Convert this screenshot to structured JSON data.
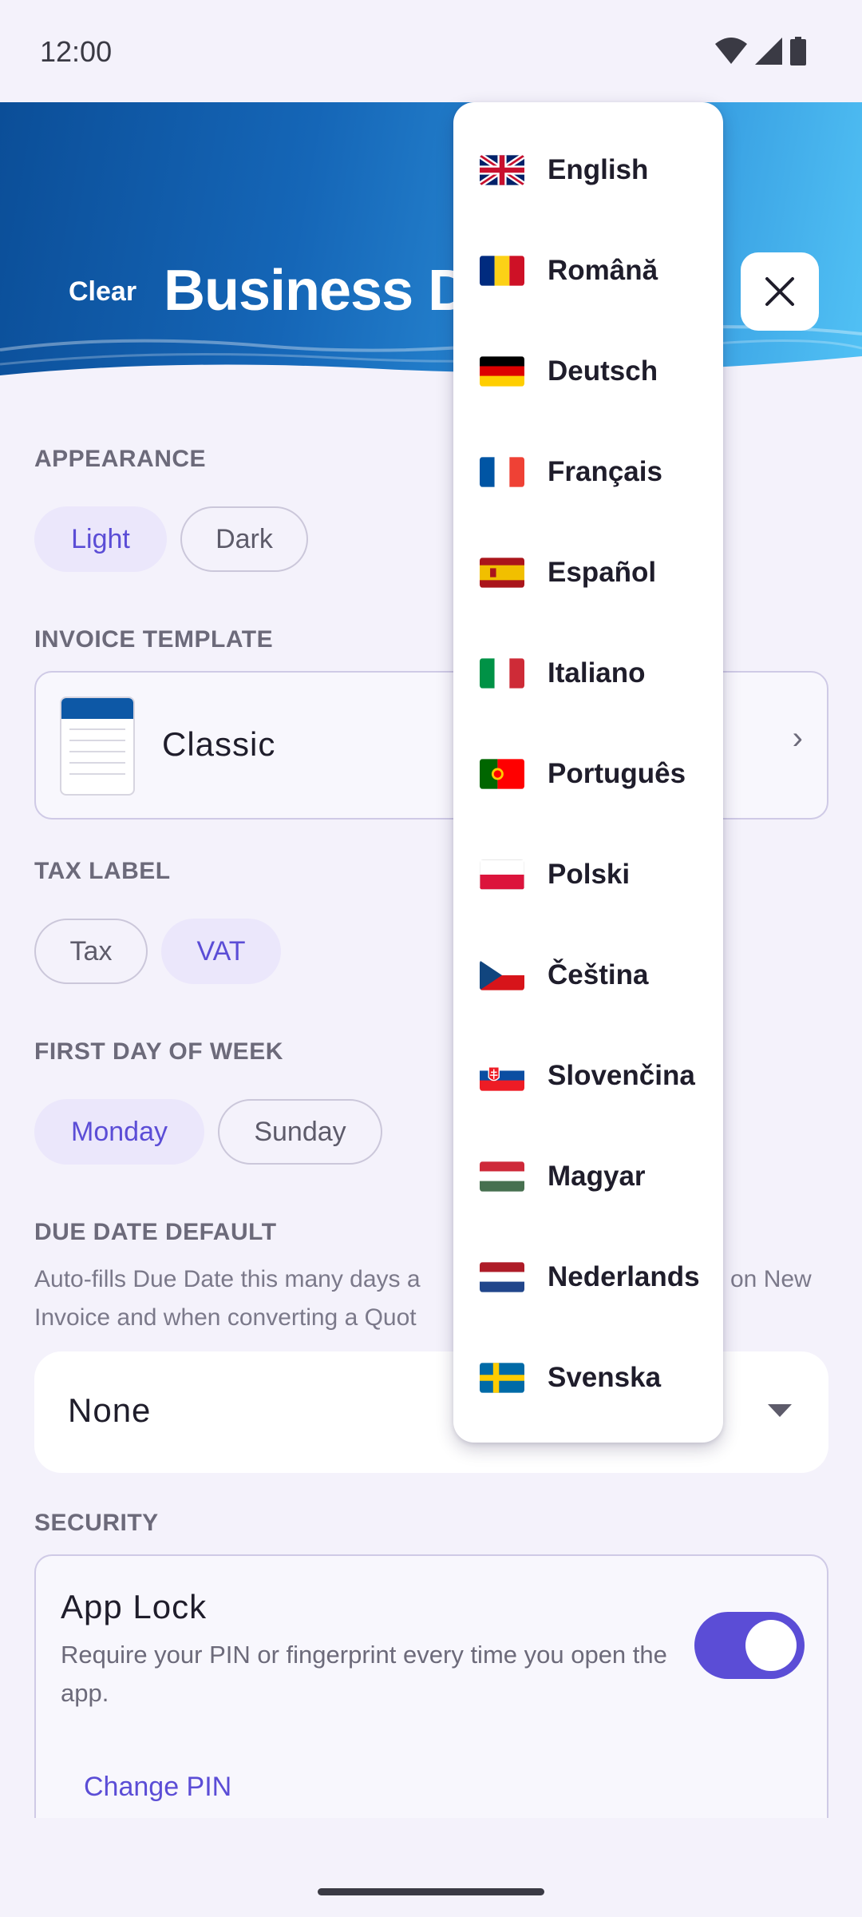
{
  "status_bar": {
    "time": "12:00"
  },
  "header": {
    "clear_label": "Clear",
    "title": "Business Details"
  },
  "appearance": {
    "label": "APPEARANCE",
    "options": [
      "Light",
      "Dark"
    ],
    "selected": "Light"
  },
  "invoice_template": {
    "label": "INVOICE TEMPLATE",
    "value": "Classic"
  },
  "tax_label": {
    "label": "TAX LABEL",
    "options": [
      "Tax",
      "VAT"
    ],
    "selected": "VAT"
  },
  "first_day": {
    "label": "FIRST DAY OF WEEK",
    "options": [
      "Monday",
      "Sunday"
    ],
    "selected": "Monday"
  },
  "due_date": {
    "label": "DUE DATE DEFAULT",
    "hint_line1": "Auto-fills Due Date this many days a",
    "hint_line1_end": "on New",
    "hint_line2": "Invoice and when converting a Quot",
    "value": "None"
  },
  "security": {
    "label": "SECURITY",
    "app_lock_title": "App Lock",
    "app_lock_desc": "Require your PIN or fingerprint every time you open the app.",
    "app_lock_enabled": true,
    "change_pin": "Change PIN"
  },
  "language_menu": {
    "items": [
      {
        "label": "English",
        "flag": "gb-flag"
      },
      {
        "label": "Română",
        "flag": "ro-flag"
      },
      {
        "label": "Deutsch",
        "flag": "de-flag"
      },
      {
        "label": "Français",
        "flag": "fr-flag"
      },
      {
        "label": "Español",
        "flag": "es-flag"
      },
      {
        "label": "Italiano",
        "flag": "it-flag"
      },
      {
        "label": "Português",
        "flag": "pt-flag"
      },
      {
        "label": "Polski",
        "flag": "pl-flag"
      },
      {
        "label": "Čeština",
        "flag": "cz-flag"
      },
      {
        "label": "Slovenčina",
        "flag": "sk-flag"
      },
      {
        "label": "Magyar",
        "flag": "hu-flag"
      },
      {
        "label": "Nederlands",
        "flag": "nl-flag"
      },
      {
        "label": "Svenska",
        "flag": "se-flag"
      }
    ]
  },
  "colors": {
    "accent": "#5b4dd6",
    "header_start": "#0b4e98",
    "header_end": "#52c2f5",
    "background": "#f4f2fb"
  }
}
